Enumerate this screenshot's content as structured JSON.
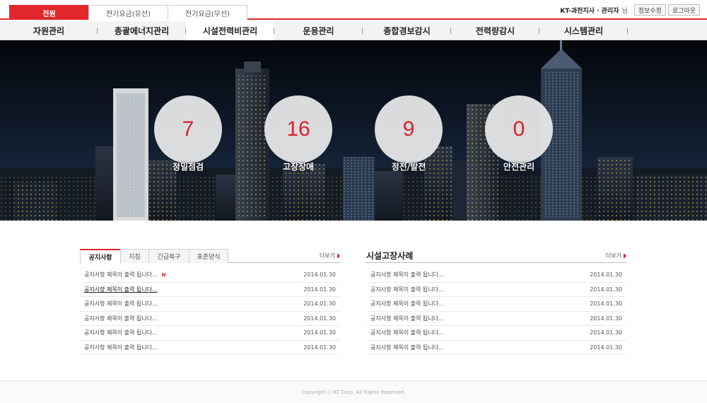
{
  "top_tabs": [
    {
      "label": "전원",
      "active": true
    },
    {
      "label": "전기요금(유선)",
      "active": false
    },
    {
      "label": "전기요금(무선)",
      "active": false
    }
  ],
  "user": {
    "name": "KT-과천지사 · 관리자",
    "suffix": "님",
    "edit_label": "정보수정",
    "logout_label": "로그아웃"
  },
  "nav": [
    {
      "label": "자원관리"
    },
    {
      "label": "총괄에너지관리"
    },
    {
      "label": "시설전력비관리",
      "active": true
    },
    {
      "label": "운용관리"
    },
    {
      "label": "종합경보감시"
    },
    {
      "label": "전력량감시"
    },
    {
      "label": "시스템관리"
    }
  ],
  "stats": [
    {
      "value": "7",
      "label": "정밀점검"
    },
    {
      "value": "16",
      "label": "고장장애"
    },
    {
      "value": "9",
      "label": "정전/발전"
    },
    {
      "value": "0",
      "label": "안전관리"
    }
  ],
  "notice": {
    "tabs": [
      {
        "label": "공지사항",
        "active": true
      },
      {
        "label": "지침"
      },
      {
        "label": "긴급복구"
      },
      {
        "label": "표준양식"
      }
    ],
    "more_label": "더보기",
    "new_badge": "N",
    "items": [
      {
        "title": "공지사항 제목이 출력 됩니다...",
        "date": "2014.01.30",
        "new": true
      },
      {
        "title": "공지사항 제목이 출력 됩니다...",
        "date": "2014.01.30",
        "highlight": true
      },
      {
        "title": "공지사항 제목이 출력 됩니다...",
        "date": "2014.01.30"
      },
      {
        "title": "공지사항 제목이 출력 됩니다...",
        "date": "2014.01.30"
      },
      {
        "title": "공지사항 제목이 출력 됩니다...",
        "date": "2014.01.30"
      },
      {
        "title": "공지사항 제목이 출력 됩니다...",
        "date": "2014.01.30"
      }
    ]
  },
  "cases": {
    "title": "시설고장사례",
    "more_label": "더보기",
    "items": [
      {
        "title": "공지사항 제목이 출력 됩니다...",
        "date": "2014.01.30"
      },
      {
        "title": "공지사항 제목이 출력 됩니다...",
        "date": "2014.01.30"
      },
      {
        "title": "공지사항 제목이 출력 됩니다...",
        "date": "2014.01.30"
      },
      {
        "title": "공지사항 제목이 출력 됩니다...",
        "date": "2014.01.30"
      },
      {
        "title": "공지사항 제목이 출력 됩니다...",
        "date": "2014.01.30"
      },
      {
        "title": "공지사항 제목이 출력 됩니다...",
        "date": "2014.01.30"
      }
    ]
  },
  "footer": {
    "copyright": "Copyright ⓒ KT Corp. All Rights Reserved."
  },
  "colors": {
    "accent": "#e1262c",
    "nav_bg": "#f3f3f3",
    "hero_bg": "#0d1624"
  }
}
